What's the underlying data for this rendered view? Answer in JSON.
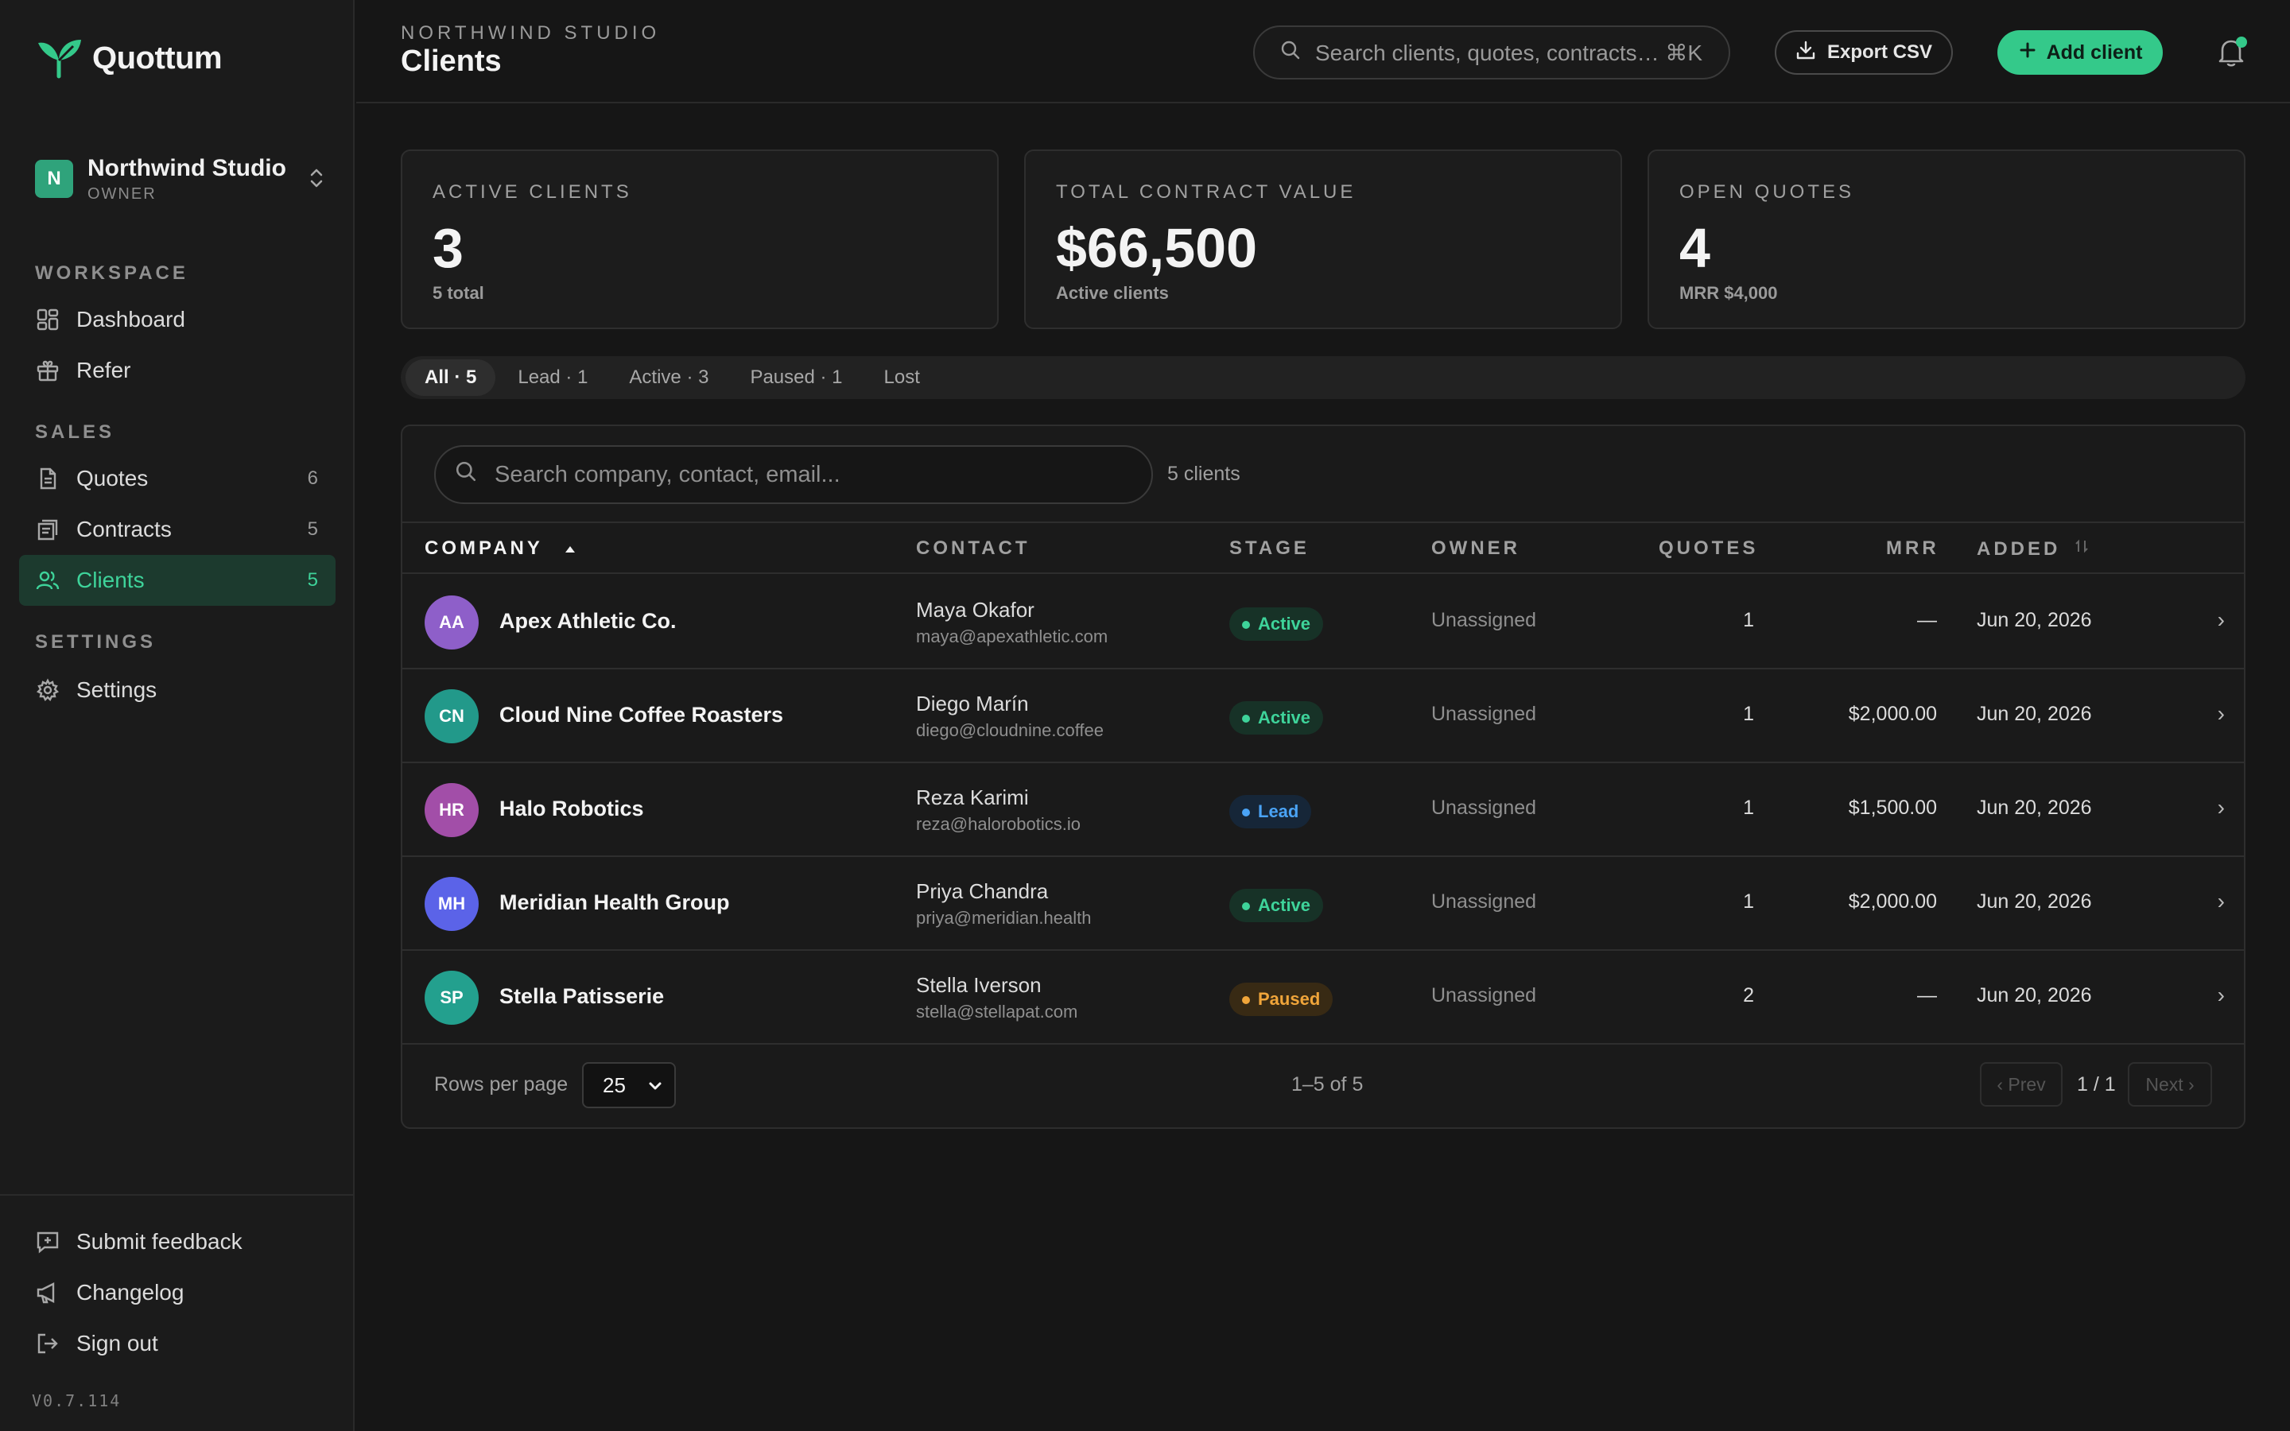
{
  "app": {
    "name": "Quottum",
    "version": "V0.7.114",
    "brand_color": "#34c98a"
  },
  "org": {
    "initial": "N",
    "name": "Northwind Studio",
    "role": "OWNER"
  },
  "sidebar": {
    "sections": [
      {
        "title": "WORKSPACE"
      },
      {
        "title": "SALES"
      },
      {
        "title": "SETTINGS"
      }
    ],
    "items": [
      {
        "label": "Dashboard",
        "icon": "dashboard-icon"
      },
      {
        "label": "Refer",
        "icon": "gift-icon"
      },
      {
        "label": "Quotes",
        "icon": "document-icon",
        "count": "6"
      },
      {
        "label": "Contracts",
        "icon": "contract-icon",
        "count": "5"
      },
      {
        "label": "Clients",
        "icon": "users-icon",
        "count": "5",
        "active": true
      },
      {
        "label": "Settings",
        "icon": "gear-icon"
      }
    ],
    "footer": [
      {
        "label": "Submit feedback",
        "icon": "feedback-icon"
      },
      {
        "label": "Changelog",
        "icon": "megaphone-icon"
      },
      {
        "label": "Sign out",
        "icon": "sign-out-icon"
      }
    ]
  },
  "header": {
    "eyebrow": "NORTHWIND STUDIO",
    "title": "Clients",
    "search_placeholder": "Search clients, quotes, contracts… ⌘K",
    "export_label": "Export CSV",
    "add_label": "Add client"
  },
  "stats": [
    {
      "label": "ACTIVE CLIENTS",
      "value": "3",
      "sub": "5 total"
    },
    {
      "label": "TOTAL CONTRACT VALUE",
      "value": "$66,500",
      "sub": "Active clients"
    },
    {
      "label": "OPEN QUOTES",
      "value": "4",
      "sub": "MRR $4,000"
    }
  ],
  "tabs": [
    {
      "label": "All · 5",
      "active": true
    },
    {
      "label": "Lead · 1"
    },
    {
      "label": "Active · 3"
    },
    {
      "label": "Paused · 1"
    },
    {
      "label": "Lost"
    }
  ],
  "table": {
    "search_placeholder": "Search company, contact, email...",
    "count_label": "5 clients",
    "columns": [
      "COMPANY",
      "CONTACT",
      "STAGE",
      "OWNER",
      "QUOTES",
      "MRR",
      "ADDED"
    ],
    "rows": [
      {
        "initials": "AA",
        "avatar_color": "#8e5fc9",
        "company": "Apex Athletic Co.",
        "contact": "Maya Okafor",
        "email": "maya@apexathletic.com",
        "stage": "Active",
        "owner": "Unassigned",
        "quotes": "1",
        "mrr": "—",
        "added": "Jun 20, 2026"
      },
      {
        "initials": "CN",
        "avatar_color": "#22998a",
        "company": "Cloud Nine Coffee Roasters",
        "contact": "Diego Marín",
        "email": "diego@cloudnine.coffee",
        "stage": "Active",
        "owner": "Unassigned",
        "quotes": "1",
        "mrr": "$2,000.00",
        "added": "Jun 20, 2026"
      },
      {
        "initials": "HR",
        "avatar_color": "#a24ea8",
        "company": "Halo Robotics",
        "contact": "Reza Karimi",
        "email": "reza@halorobotics.io",
        "stage": "Lead",
        "owner": "Unassigned",
        "quotes": "1",
        "mrr": "$1,500.00",
        "added": "Jun 20, 2026"
      },
      {
        "initials": "MH",
        "avatar_color": "#5b63e8",
        "company": "Meridian Health Group",
        "contact": "Priya Chandra",
        "email": "priya@meridian.health",
        "stage": "Active",
        "owner": "Unassigned",
        "quotes": "1",
        "mrr": "$2,000.00",
        "added": "Jun 20, 2026"
      },
      {
        "initials": "SP",
        "avatar_color": "#23a08e",
        "company": "Stella Patisserie",
        "contact": "Stella Iverson",
        "email": "stella@stellapat.com",
        "stage": "Paused",
        "owner": "Unassigned",
        "quotes": "2",
        "mrr": "—",
        "added": "Jun 20, 2026"
      }
    ],
    "stage_colors": {
      "Active": {
        "fg": "#3ed39a",
        "bg": "#173227"
      },
      "Lead": {
        "fg": "#4aa3f5",
        "bg": "#162638"
      },
      "Paused": {
        "fg": "#f0a53a",
        "bg": "#382a14"
      }
    },
    "footer": {
      "rows_per_page_label": "Rows per page",
      "rows_per_page": "25",
      "range": "1–5 of 5",
      "prev": "‹ Prev",
      "page": "1 / 1",
      "next": "Next ›"
    }
  }
}
